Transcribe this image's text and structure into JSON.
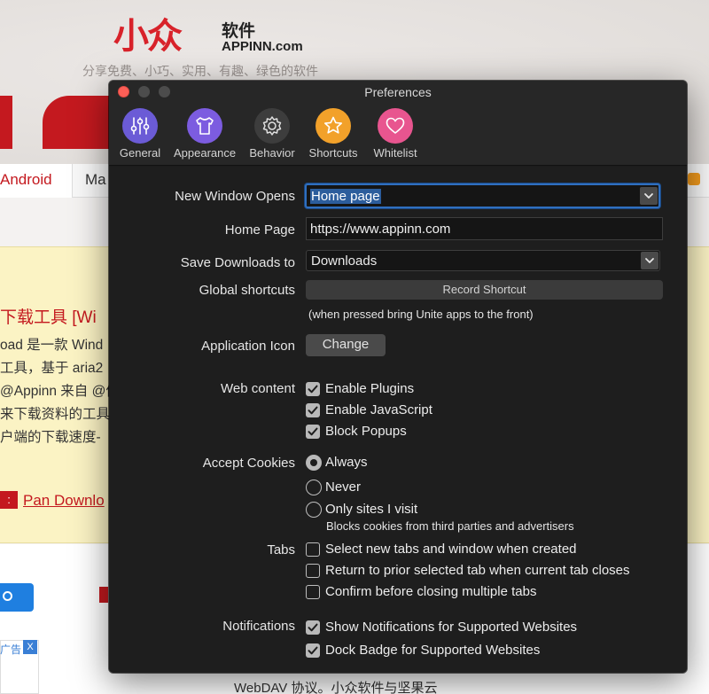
{
  "background": {
    "logo_mark": "小众",
    "logo_cn": "软件",
    "logo_en": "APPINN.com",
    "slogan": "分享免费、小巧、实用、有趣、绿色的软件",
    "nav": {
      "android": "Android",
      "partial": "Ma"
    },
    "article": {
      "title": "下载工具 [Wi",
      "lines": [
        "oad 是一款 Wind",
        "工具，基于 aria2",
        "@Appinn 来自 @依",
        "来下载资料的工具",
        "户端的下载速度-"
      ],
      "pan_tag": ":",
      "pan_link": "Pan Downlo"
    },
    "ad_text": "广告",
    "ad_close": "X",
    "bottom_text": "WebDAV 协议。小众软件与坚果云"
  },
  "window": {
    "title": "Preferences",
    "toolbar": [
      {
        "label": "General",
        "icon": "sliders-icon",
        "color": "#6b5bd6"
      },
      {
        "label": "Appearance",
        "icon": "shirt-icon",
        "color": "#7c5ce0"
      },
      {
        "label": "Behavior",
        "icon": "gear-icon",
        "color": "#3d3d3d"
      },
      {
        "label": "Shortcuts",
        "icon": "star-icon",
        "color": "#f2a12a"
      },
      {
        "label": "Whitelist",
        "icon": "heart-icon",
        "color": "#e8558f"
      }
    ],
    "settings": {
      "new_window_opens": {
        "label": "New Window Opens",
        "value": "Home page"
      },
      "home_page": {
        "label": "Home Page",
        "value": "https://www.appinn.com"
      },
      "save_downloads": {
        "label": "Save Downloads to",
        "value": "Downloads"
      },
      "global_shortcuts": {
        "label": "Global shortcuts",
        "button": "Record Shortcut",
        "hint": "(when pressed bring Unite apps to the front)"
      },
      "application_icon": {
        "label": "Application Icon",
        "button": "Change"
      },
      "web_content": {
        "label": "Web content",
        "options": [
          {
            "label": "Enable Plugins",
            "checked": true
          },
          {
            "label": "Enable JavaScript",
            "checked": true
          },
          {
            "label": "Block Popups",
            "checked": true
          }
        ]
      },
      "accept_cookies": {
        "label": "Accept Cookies",
        "options": [
          {
            "label": "Always",
            "selected": true
          },
          {
            "label": "Never",
            "selected": false
          },
          {
            "label": "Only sites I visit",
            "selected": false
          }
        ],
        "hint": "Blocks cookies from third parties and advertisers"
      },
      "tabs": {
        "label": "Tabs",
        "options": [
          {
            "label": "Select new tabs and window when created",
            "checked": false
          },
          {
            "label": "Return to prior selected tab when current tab closes",
            "checked": false
          },
          {
            "label": "Confirm before closing multiple tabs",
            "checked": false
          }
        ]
      },
      "notifications": {
        "label": "Notifications",
        "options": [
          {
            "label": "Show Notifications for Supported Websites",
            "checked": true
          },
          {
            "label": "Dock Badge for Supported Websites",
            "checked": true
          }
        ]
      }
    }
  }
}
